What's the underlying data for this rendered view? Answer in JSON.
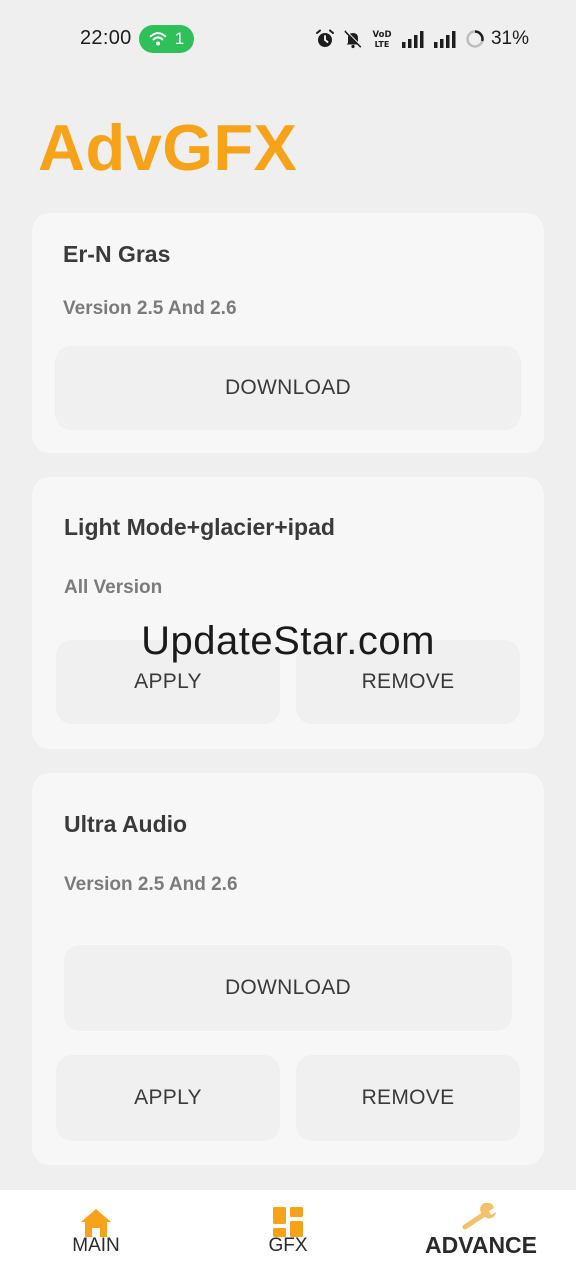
{
  "status_bar": {
    "time": "22:00",
    "hotspot_count": "1",
    "battery": "31%",
    "icons": [
      "alarm-icon",
      "mute-icon",
      "volte-icon",
      "signal-icon",
      "signal-icon",
      "battery-ring-icon"
    ]
  },
  "app": {
    "title": "AdvGFX",
    "accent_color": "#f6a31a"
  },
  "cards": [
    {
      "title": "Er-N Gras",
      "subtitle": "Version 2.5 And 2.6",
      "download_label": "DOWNLOAD"
    },
    {
      "title": "Light Mode+glacier+ipad",
      "subtitle": "All Version",
      "apply_label": "APPLY",
      "remove_label": "REMOVE"
    },
    {
      "title": "Ultra Audio",
      "subtitle": "Version 2.5 And 2.6",
      "download_label": "DOWNLOAD",
      "apply_label": "APPLY",
      "remove_label": "REMOVE"
    }
  ],
  "watermark": "UpdateStar.com",
  "nav": {
    "items": [
      {
        "label": "MAIN",
        "icon": "home-icon"
      },
      {
        "label": "GFX",
        "icon": "grid-icon"
      },
      {
        "label": "ADVANCE",
        "icon": "wrench-icon",
        "active": true
      }
    ]
  }
}
